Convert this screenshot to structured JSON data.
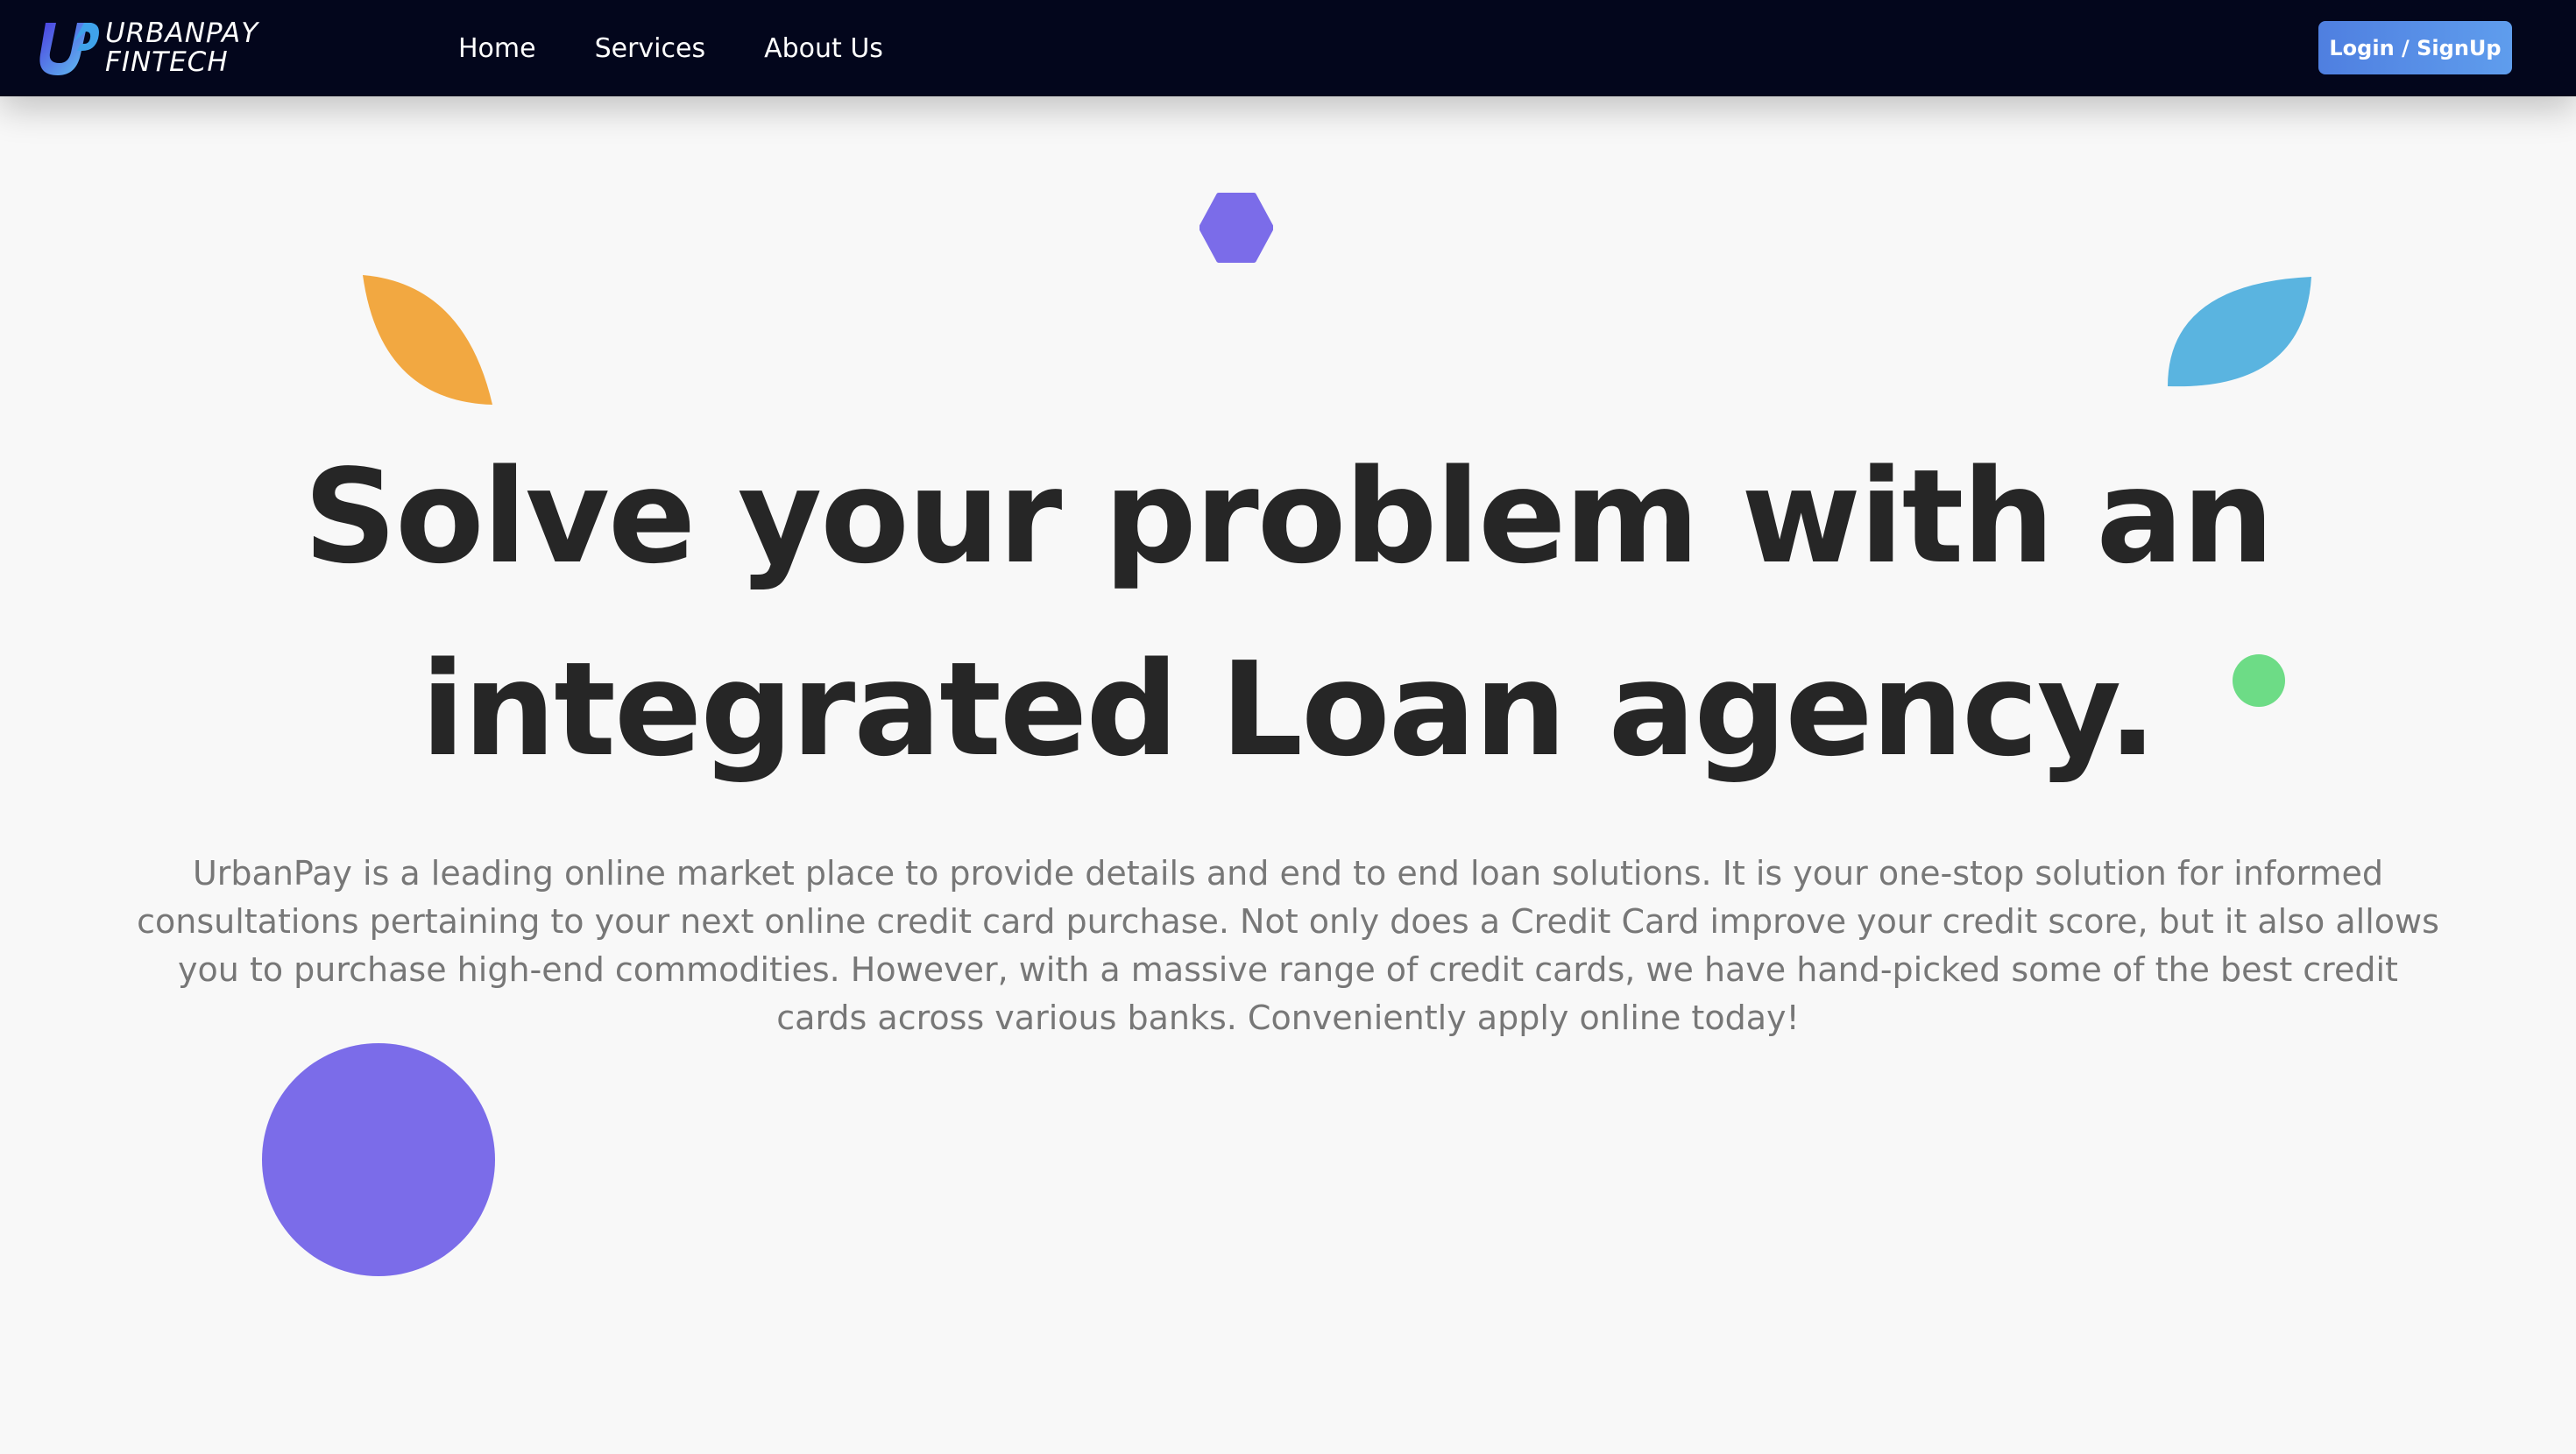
{
  "brand": {
    "line1": "URBANPAY",
    "line2": "FINTECH",
    "logo_icon": "up-monogram-icon"
  },
  "nav": {
    "items": [
      {
        "label": "Home"
      },
      {
        "label": "Services"
      },
      {
        "label": "About Us"
      }
    ],
    "login_label": "Login / SignUp"
  },
  "hero": {
    "title_line1": "Solve your problem with an",
    "title_line2": "integrated Loan agency.",
    "description": "UrbanPay is a leading online market place to provide details and end to end loan solutions. It is your one-stop solution for informed consultations pertaining to your next online credit card purchase. Not only does a Credit Card improve your credit score, but it also allows you to purchase high-end commodities. However, with a massive range of credit cards, we have hand-picked some of the best credit cards across various banks. Conveniently apply online today!"
  },
  "decorations": [
    {
      "name": "purple-hexagon-shape",
      "color": "#7b6ce9"
    },
    {
      "name": "orange-leaf-shape",
      "color": "#f2a841"
    },
    {
      "name": "blue-leaf-shape",
      "color": "#5ab4e0"
    },
    {
      "name": "green-dot-shape",
      "color": "#6ddc86"
    },
    {
      "name": "purple-circle-shape",
      "color": "#7b6ce9"
    }
  ],
  "colors": {
    "nav_background": "#03061c",
    "page_background": "#f8f8f8",
    "login_button": "#5b8fe8",
    "title_text": "#262626",
    "body_text": "#777777"
  }
}
